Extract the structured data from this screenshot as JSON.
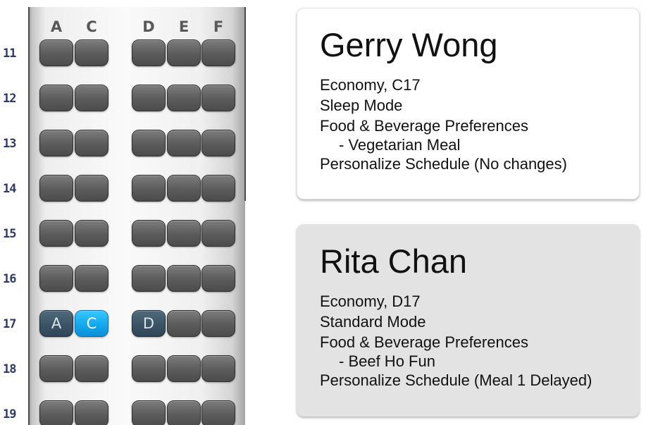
{
  "seat_map": {
    "columns": [
      "A",
      "C",
      "D",
      "E",
      "F"
    ],
    "rows": [
      "11",
      "12",
      "13",
      "14",
      "15",
      "16",
      "17",
      "18",
      "19"
    ],
    "selected_row": "17",
    "selected_seats": [
      {
        "column": "A",
        "label": "A",
        "style": "dark"
      },
      {
        "column": "C",
        "label": "C",
        "style": "bright"
      },
      {
        "column": "D",
        "label": "D",
        "style": "dark"
      }
    ],
    "colors": {
      "seat": "#5b5b5b",
      "selected_dark": "#3b5465",
      "selected_bright": "#12a9ee"
    }
  },
  "passengers": [
    {
      "name": "Gerry Wong",
      "class_seat": "Economy, C17",
      "mode": "Sleep Mode",
      "food_heading": "Food & Beverage Preferences",
      "food_item": "- Vegetarian Meal",
      "schedule": "Personalize Schedule (No changes)",
      "card_color": "#ffffff"
    },
    {
      "name": "Rita Chan",
      "class_seat": "Economy, D17",
      "mode": "Standard Mode",
      "food_heading": "Food & Beverage Preferences",
      "food_item": "- Beef Ho Fun",
      "schedule": "Personalize Schedule (Meal 1 Delayed)",
      "card_color": "#e3e3e3"
    }
  ]
}
